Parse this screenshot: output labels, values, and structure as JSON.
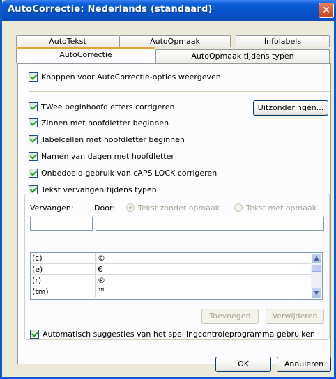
{
  "window": {
    "title": "AutoCorrectie: Nederlands (standaard)"
  },
  "tabs": [
    {
      "label": "AutoTekst"
    },
    {
      "label": "AutoOpmaak"
    },
    {
      "label": "Infolabels"
    },
    {
      "label": "AutoCorrectie"
    },
    {
      "label": "AutoOpmaak tijdens typen"
    }
  ],
  "options": {
    "show_buttons": "Knoppen voor AutoCorrectie-opties weergeven",
    "two_initials": "TWee beginhoofdletters corrigeren",
    "sentence_caps": "Zinnen met hoofdletter beginnen",
    "table_caps": "Tabelcellen met hoofdletter beginnen",
    "day_names": "Namen van dagen met hoofdletter",
    "caps_lock": "Onbedoeld gebruik van cAPS LOCK corrigeren",
    "replace_text": "Tekst vervangen tijdens typen",
    "spelling_suggestions": "Automatisch suggesties van het spellingcontroleprogramma gebruiken"
  },
  "buttons": {
    "exceptions": "Uitzonderingen...",
    "add": "Toevoegen",
    "delete": "Verwijderen",
    "ok": "OK",
    "cancel": "Annuleren"
  },
  "replace": {
    "replace_label": "Vervangen:",
    "with_label": "Door:",
    "plain_text": "Tekst zonder opmaak",
    "formatted_text": "Tekst met opmaak",
    "replace_value": "",
    "with_value": ""
  },
  "entries": [
    {
      "from": "(c)",
      "to": "©"
    },
    {
      "from": "(e)",
      "to": "€"
    },
    {
      "from": "(r)",
      "to": "®"
    },
    {
      "from": "(tm)",
      "to": "™"
    }
  ]
}
